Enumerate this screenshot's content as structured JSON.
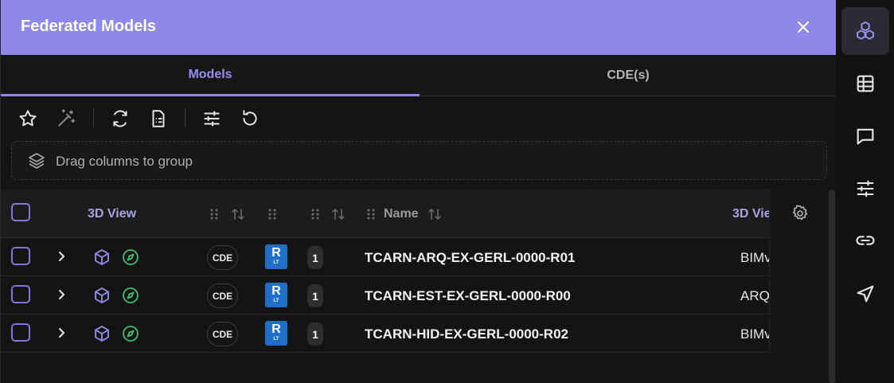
{
  "header": {
    "title": "Federated Models"
  },
  "tabs": [
    {
      "label": "Models",
      "active": true
    },
    {
      "label": "CDE(s)",
      "active": false
    }
  ],
  "group_bar": {
    "placeholder": "Drag columns to group"
  },
  "columns": {
    "view3d_primary": "3D View",
    "name": "Name",
    "view3d_secondary": "3D Vie"
  },
  "rows": [
    {
      "cde": "CDE",
      "revit_letter": "R",
      "revit_sub": "LT",
      "version": "1",
      "name": "TCARN-ARQ-EX-GERL-0000-R01",
      "view": "BIMv"
    },
    {
      "cde": "CDE",
      "revit_letter": "R",
      "revit_sub": "LT",
      "version": "1",
      "name": "TCARN-EST-EX-GERL-0000-R00",
      "view": "ARQ"
    },
    {
      "cde": "CDE",
      "revit_letter": "R",
      "revit_sub": "LT",
      "version": "1",
      "name": "TCARN-HID-EX-GERL-0000-R02",
      "view": "BIMv"
    }
  ],
  "icons": {
    "toolbar": [
      "star-icon",
      "magic-wand-icon",
      "refresh-icon",
      "document-list-icon",
      "sliders-icon",
      "reset-icon"
    ],
    "rail": [
      "cubes-icon",
      "table-icon",
      "comment-icon",
      "sliders-icon",
      "link-icon",
      "send-icon"
    ]
  },
  "colors": {
    "accent": "#8f88e8",
    "header_bg": "#8f88e8",
    "compass_green": "#3fbf6f",
    "revit_blue": "#1f6fc9"
  }
}
